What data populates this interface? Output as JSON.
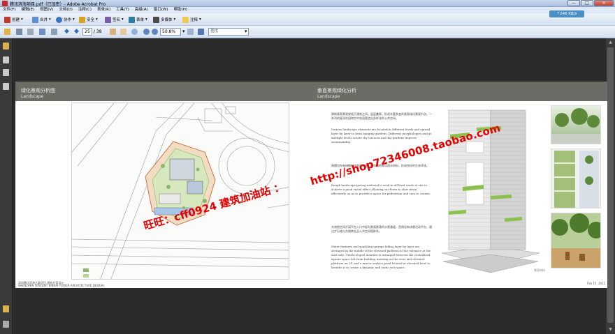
{
  "window": {
    "title": "腾讯滨海项目.pdf（已加密）- Adobe Acrobat Pro",
    "minimize": "—",
    "maximize": "□",
    "close": "✕"
  },
  "menu": [
    "文件(F)",
    "编辑(E)",
    "视图(V)",
    "文档(D)",
    "注释(C)",
    "表单(R)",
    "工具(T)",
    "高级(A)",
    "窗口(W)",
    "帮助(H)"
  ],
  "toolbar": {
    "create": "创建",
    "combine": "合并",
    "collaborate": "协作",
    "secure": "安全",
    "sign": "签名",
    "forms": "表单",
    "multimedia": "多媒体",
    "comment": "注释"
  },
  "network_speed": "↑246 KB/s",
  "nav": {
    "page_current": "25",
    "page_total": "/ 38",
    "zoom": "50.8%",
    "find_placeholder": "查找"
  },
  "document": {
    "left_title": "绿化景观分析图",
    "left_subtitle": "Landscape",
    "right_title": "垂直景观绿化分析",
    "right_subtitle": "Landscape",
    "legend": [
      "",
      "",
      "",
      "",
      ""
    ],
    "para1_cn": "建筑垂直景观穿插于建筑之间，层层叠翠，形成丰富多变的垂直绿化景观节点。一系列的屋顶花园和空中花园营造出多样化的公共空间。",
    "para1_en": "Various landscape elements are located in different levels and spread layer by layer to form hanging gardens. Different morphologies and at multiple levels create sky terraces and sky gardens improve sustainability.",
    "para2_cn": "周围均布有绿植形成各层景观，硬质铺地采用透水材料，形成良好的生态环境。",
    "para2_en": "Rough landscape paving material is used in all hard roads at site to achieve a good visual effect allowing car flows to slow down effectively, so as to provide a space for pedestrian and cars to coexist.",
    "para3_cn": "东南侧空间开阔平台入口中部为景观跌落的水景通道，西侧设有休憩活动平台，通过步行道与东侧商业及公共空间相联系。",
    "para3_en": "Water features and sparkling springs falling layer by layer are arranged in the middle of the elevated platform at the entrance at the east side. Gentle sloped meadow is arranged between the centralized square space left from building massing on the west and elevated platform on 2F, and a mirror surface pond located at elevated level to breathe it to create a dynamic and static rich space.",
    "photo_caption": "景观材料",
    "footer_cn": "深圳腾讯滨海大厦项目  建筑方案设计",
    "footer_en": "SHENZHEN TENCENT BINHAI TOWER ARCHITECTURE DESIGN",
    "footer_right": "Feb 15, 2011"
  },
  "watermark": {
    "line1": "旺旺：cff0924  建筑加油站 ：http://shop72346008.taobao.com",
    "part_a": "旺旺：cff0924  建筑加油站 ：",
    "part_b": "http://shop72346008.taobao.com"
  },
  "colors": {
    "accent_red": "#e60000",
    "header_gray": "#6c6b66",
    "dark_bg": "#2b2b2b"
  }
}
